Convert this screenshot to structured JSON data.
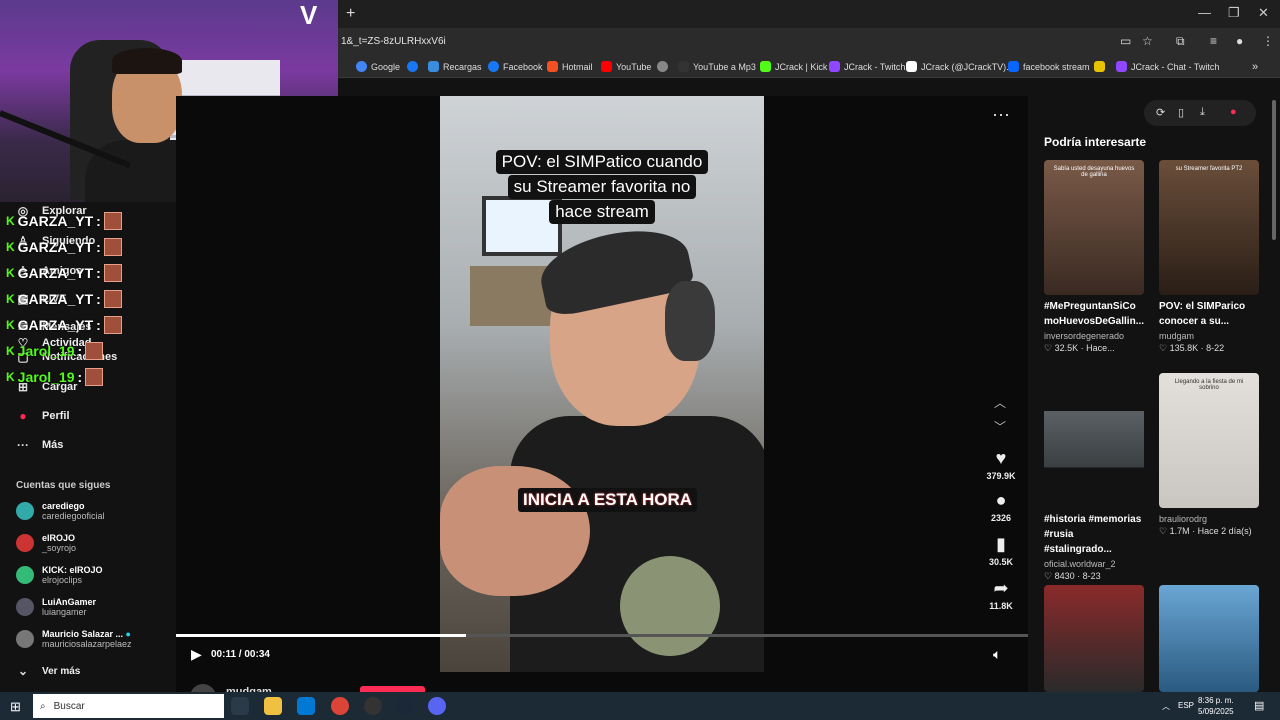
{
  "browser": {
    "url": "1&_t=ZS-8zULRHxxV6i",
    "new_tab_icon": "+",
    "bookmarks": [
      {
        "label": "Google",
        "color": "#4285f4"
      },
      {
        "label": "",
        "color": "#1877f2"
      },
      {
        "label": "Recargas",
        "color": "#3a8dde"
      },
      {
        "label": "Facebook",
        "color": "#1877f2"
      },
      {
        "label": "Hotmail",
        "color": "#f25022"
      },
      {
        "label": "YouTube",
        "color": "#ff0000"
      },
      {
        "label": "",
        "color": "#888888"
      },
      {
        "label": "YouTube a Mp3",
        "color": "#333333"
      },
      {
        "label": "JCrack | Kick",
        "color": "#53fc18"
      },
      {
        "label": "JCrack - Twitch",
        "color": "#9146ff"
      },
      {
        "label": "JCrack (@JCrackTV)...",
        "color": "#ffffff"
      },
      {
        "label": "facebook stream",
        "color": "#0866ff"
      },
      {
        "label": "",
        "color": "#e6c300"
      },
      {
        "label": "JCrack - Chat - Twitch",
        "color": "#9146ff"
      }
    ]
  },
  "sidebar": {
    "nav": [
      {
        "label": "Explorar",
        "icon": "compass-icon"
      },
      {
        "label": "Siguiendo",
        "icon": "user-icon"
      },
      {
        "label": "Amigos",
        "icon": "friends-icon"
      },
      {
        "label": "LIVE",
        "icon": "live-icon"
      },
      {
        "label": "Mensajes",
        "icon": "message-icon"
      },
      {
        "label": "Actividad",
        "icon": "activity-icon"
      },
      {
        "label": "Notificaciones",
        "icon": "bell-icon"
      },
      {
        "label": "Cargar",
        "icon": "upload-icon"
      },
      {
        "label": "Perfil",
        "icon": "profile-icon"
      },
      {
        "label": "Más",
        "icon": "more-icon"
      }
    ],
    "following_title": "Cuentas que sigues",
    "following": [
      {
        "name": "carediego",
        "handle": "carediegooficial",
        "color": "#3aa"
      },
      {
        "name": "elROJO",
        "handle": "_soyrojo",
        "color": "#c33"
      },
      {
        "name": "KICK: elROJO",
        "handle": "elrojoclips",
        "color": "#3b7"
      },
      {
        "name": "LuiAnGamer",
        "handle": "luiangamer",
        "color": "#556"
      },
      {
        "name": "Mauricio Salazar ...",
        "handle": "mauriciosalazarpelaez",
        "color": "#777"
      }
    ],
    "see_more": "Ver más"
  },
  "chat": [
    {
      "user": "GARZA_YT",
      "green": false
    },
    {
      "user": "GARZA_YT",
      "green": false
    },
    {
      "user": "GARZA_YT",
      "green": false
    },
    {
      "user": "GARZA_YT",
      "green": false
    },
    {
      "user": "GARZA_YT",
      "green": false
    },
    {
      "user": "Jarol_19",
      "green": true
    },
    {
      "user": "Jarol_19",
      "green": true
    }
  ],
  "video": {
    "caption_lines": [
      "POV: el SIMPatico cuando",
      "su Streamer favorita no",
      "hace stream"
    ],
    "caption_mid": "INICIA A ESTA HORA",
    "time": "00:11 / 00:34",
    "progress": 0.34,
    "author": "mudgam",
    "likes": "379.9K",
    "comments": "2326",
    "saves": "30.5K",
    "shares": "11.8K"
  },
  "recommend": {
    "title": "Podría interesarte",
    "cards": [
      {
        "title": "#MePreguntanSiCo moHuevosDeGallin...",
        "user": "inversordegenerado",
        "meta": "♡ 32.5K · Hace...",
        "bg": "#6a4b3a",
        "text": "Sabía usted desayuna huevos de gallina"
      },
      {
        "title": "POV: el SIMParico conocer a su...",
        "user": "mudgam",
        "meta": "♡ 135.8K · 8-22",
        "bg": "#5a3e2e",
        "text": "su Streamer favorita PT2"
      },
      {
        "title": "#historia #memorias #rusia #stalingrado...",
        "user": "oficial.worldwar_2",
        "meta": "♡ 8430 · 8-23",
        "bg": "#4a4f52",
        "text": ""
      },
      {
        "title": "",
        "user": "brauliorodrg",
        "meta": "♡ 1.7M · Hace 2 día(s)",
        "bg": "#d9d6d1",
        "text": "Llegando a la fiesta de mi sobrino"
      },
      {
        "title": "",
        "user": "",
        "meta": "",
        "bg": "#7a2a2a",
        "text": ""
      },
      {
        "title": "",
        "user": "",
        "meta": "",
        "bg": "#4c88b8",
        "text": ""
      }
    ]
  },
  "taskbar": {
    "search_placeholder": "Buscar",
    "lang": "ESP",
    "time": "8:36 p. m.",
    "date": "5/09/2025"
  }
}
